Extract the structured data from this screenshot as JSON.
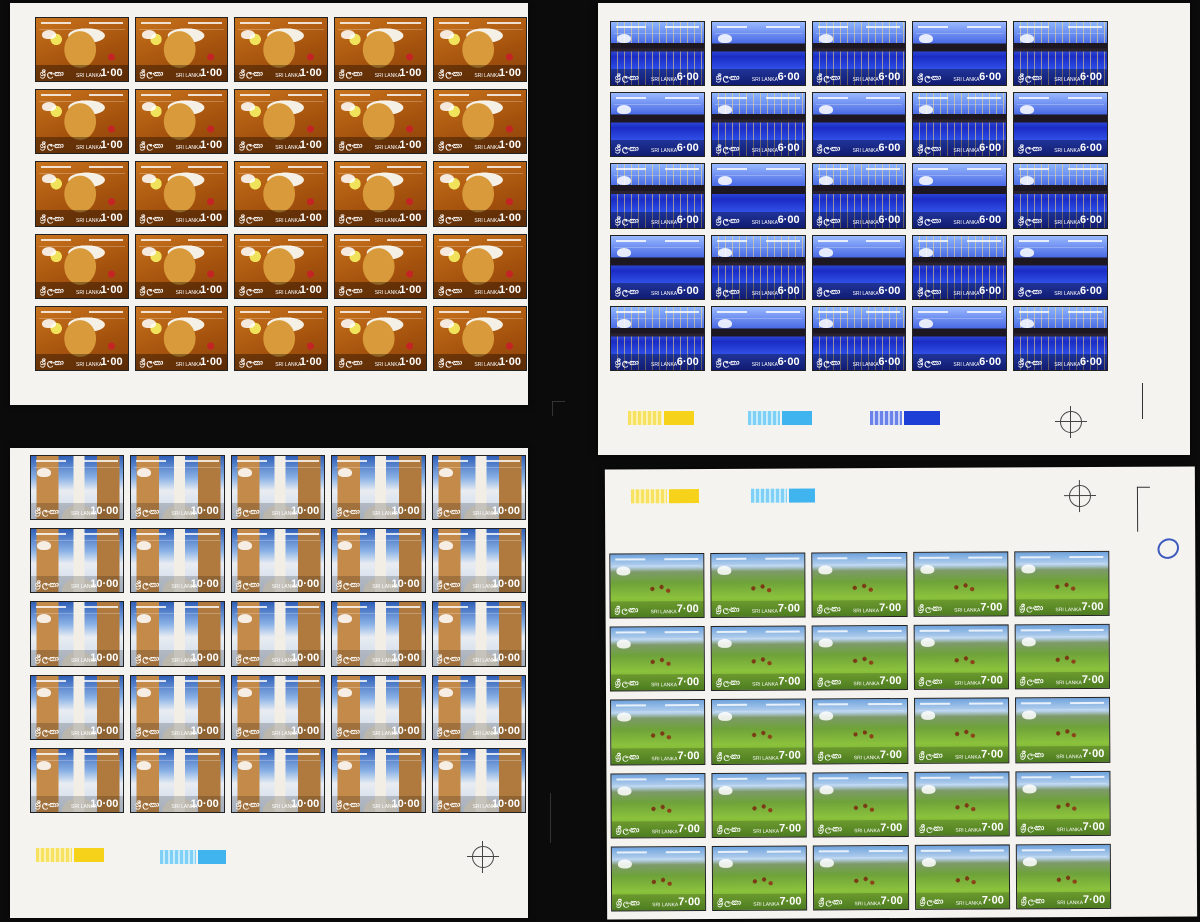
{
  "sheets": [
    {
      "id": "sheet-1-00",
      "design": "d-orange",
      "value": "1·00",
      "lanka": "ශ්‍රී ලංකා",
      "country": "SRI LANKA"
    },
    {
      "id": "sheet-6-00",
      "design": "d-blue",
      "value": "6·00",
      "lanka": "ශ්‍රී ලංකා",
      "country": "SRI LANKA"
    },
    {
      "id": "sheet-10-00",
      "design": "d-stupa",
      "value": "10·00",
      "lanka": "ශ්‍රී ලංකා",
      "country": "SRI LANKA"
    },
    {
      "id": "sheet-7-00",
      "design": "d-green",
      "value": "7·00",
      "lanka": "ශ්‍රී ලංකා",
      "country": "SRI LANKA"
    }
  ],
  "colors": {
    "background": "#0b0b0b",
    "sheet": "#f4f3ef",
    "orange": "#b35e12",
    "blue": "#2a45d8",
    "green": "#74ad34",
    "sky": "#8bb2e6"
  }
}
